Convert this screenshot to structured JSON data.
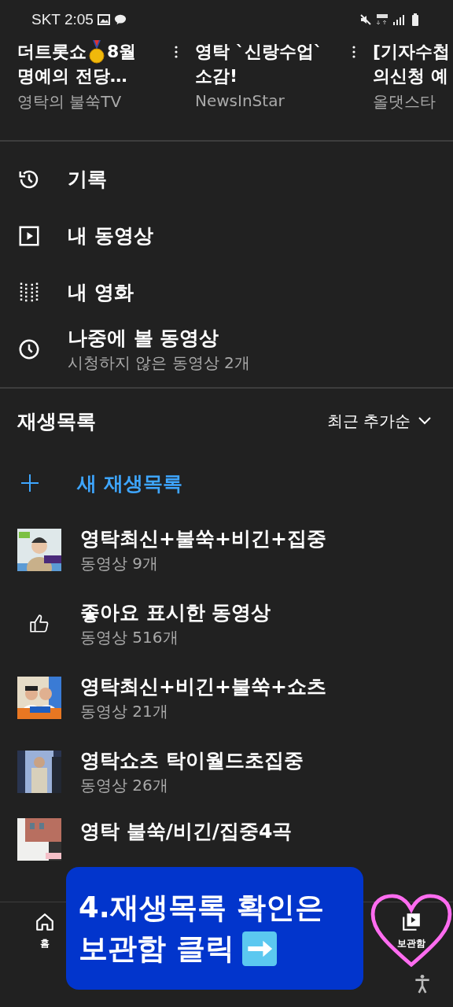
{
  "status_bar": {
    "carrier": "SKT",
    "time": "2:05"
  },
  "shelf": [
    {
      "lines": [
        {
          "parts": [
            "더트롯쇼",
            "8월"
          ],
          "medal": true
        },
        {
          "parts": [
            "명예의 전당…"
          ]
        }
      ],
      "channel": "영탁의 불쑥TV"
    },
    {
      "lines": [
        {
          "parts": [
            "영탁 `신랑수업`"
          ]
        },
        {
          "parts": [
            "소감!"
          ]
        }
      ],
      "channel": "NewsInStar"
    },
    {
      "lines": [
        {
          "parts": [
            "[기자수첩"
          ]
        },
        {
          "parts": [
            "의신청 예"
          ]
        }
      ],
      "channel": "올댓스타"
    }
  ],
  "menu": [
    {
      "kind": "history",
      "label": "기록"
    },
    {
      "kind": "videos",
      "label": "내 동영상"
    },
    {
      "kind": "movies",
      "label": "내 영화"
    },
    {
      "kind": "later",
      "label": "나중에 볼 동영상",
      "subtitle": "시청하지 않은 동영상 2개"
    }
  ],
  "playlists_header": {
    "title": "재생목록",
    "sort": "최근 추가순"
  },
  "new_playlist": {
    "label": "새 재생목록"
  },
  "playlists": [
    {
      "kind": "thumb",
      "title": "영탁최신+불쑥+비긴+집중",
      "count": "동영상 9개"
    },
    {
      "kind": "liked",
      "title": "좋아요 표시한 동영상",
      "count": "동영상 516개"
    },
    {
      "kind": "thumb",
      "title": "영탁최신+비긴+불쑥+쇼츠",
      "count": "동영상 21개"
    },
    {
      "kind": "thumb",
      "title": "영탁쇼츠 탁이월드초집중",
      "count": "동영상 26개"
    },
    {
      "kind": "thumb",
      "title": "영탁 불쑥/비긴/집중4곡"
    }
  ],
  "bottom_nav": [
    {
      "kind": "home",
      "label": "홈",
      "selected": false
    },
    {
      "kind": "library",
      "label": "보관함",
      "selected": true
    }
  ],
  "banner": {
    "text": "4.재생목록 확인은\n보관함 클릭"
  }
}
